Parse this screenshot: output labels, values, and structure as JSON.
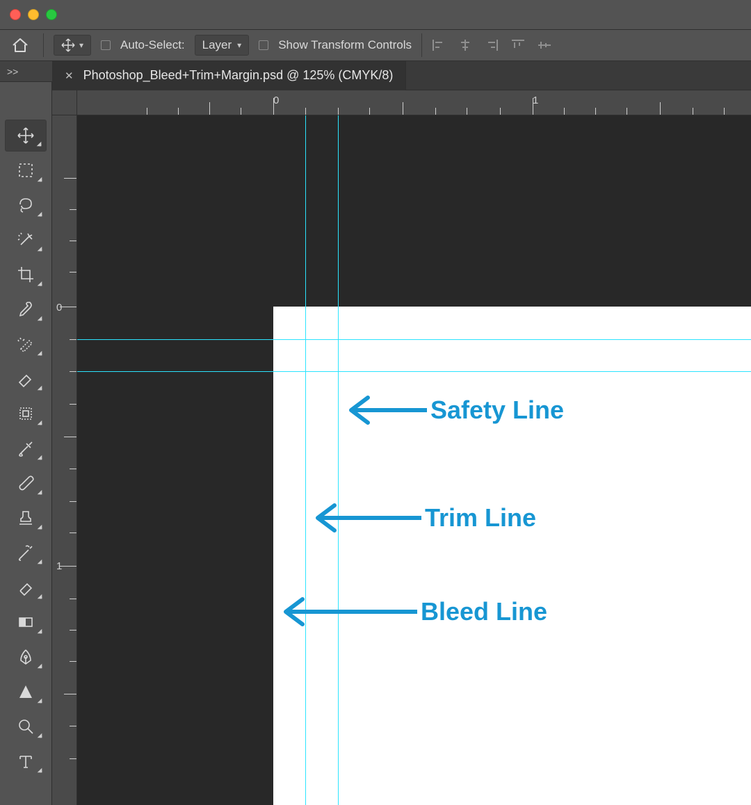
{
  "titlebar": {},
  "options": {
    "auto_select_label": "Auto-Select:",
    "layer_label": "Layer",
    "show_transform_label": "Show Transform Controls"
  },
  "collapse_arrows": ">>",
  "document": {
    "tab_title": "Photoshop_Bleed+Trim+Margin.psd @ 125% (CMYK/8)"
  },
  "rulers": {
    "h": [
      "0",
      "1"
    ],
    "v": [
      "0",
      "1"
    ]
  },
  "tools": [
    "move",
    "marquee",
    "lasso",
    "magic-wand",
    "crop",
    "eyedropper",
    "spot-healing",
    "eraser",
    "clone",
    "history-brush",
    "brush",
    "stamp",
    "mixer-brush",
    "eraser2",
    "gradient",
    "pen",
    "triangle",
    "zoom",
    "type"
  ],
  "annotations": {
    "safety": "Safety Line",
    "trim": "Trim Line",
    "bleed": "Bleed Line"
  }
}
